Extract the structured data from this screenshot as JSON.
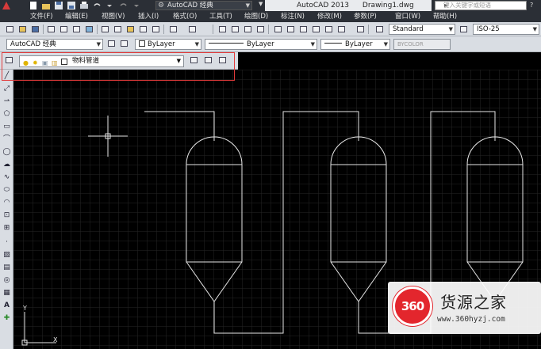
{
  "titlebar": {
    "workspace": "AutoCAD 经典",
    "app_name": "AutoCAD 2013",
    "file_name": "Drawing1.dwg",
    "search_placeholder": "键入关键字或短语"
  },
  "menu": [
    "文件(F)",
    "编辑(E)",
    "视图(V)",
    "插入(I)",
    "格式(O)",
    "工具(T)",
    "绘图(D)",
    "标注(N)",
    "修改(M)",
    "参数(P)",
    "窗口(W)",
    "帮助(H)"
  ],
  "styles_toolbar": {
    "workspace_combo": "AutoCAD 经典",
    "color_combo": "ByLayer",
    "linetype_combo": "ByLayer",
    "lineweight_combo": "ByLayer",
    "plotstyle_combo": "BYCOLOR",
    "text_style": "Standard",
    "dim_style": "ISO-25"
  },
  "layers_toolbar": {
    "current_layer": "物料管道"
  },
  "draw_tools": [
    "line-icon",
    "construction-line-icon",
    "polyline-icon",
    "polygon-icon",
    "rectangle-icon",
    "arc-icon",
    "circle-icon",
    "revcloud-icon",
    "spline-icon",
    "ellipse-icon",
    "ellipse-arc-icon",
    "insert-block-icon",
    "make-block-icon",
    "point-icon",
    "hatch-icon",
    "gradient-icon",
    "region-icon",
    "table-icon",
    "multiline-text-icon",
    "add-selected-icon"
  ],
  "colors": {
    "background": "#000000",
    "grid": "#262626",
    "geometry": "#e6e6e6",
    "highlight": "#e23b3b",
    "brand_red": "#e3262d"
  },
  "watermark": {
    "logo_text": "360",
    "brand": "货源之家",
    "url": "www.360hyzj.com"
  }
}
